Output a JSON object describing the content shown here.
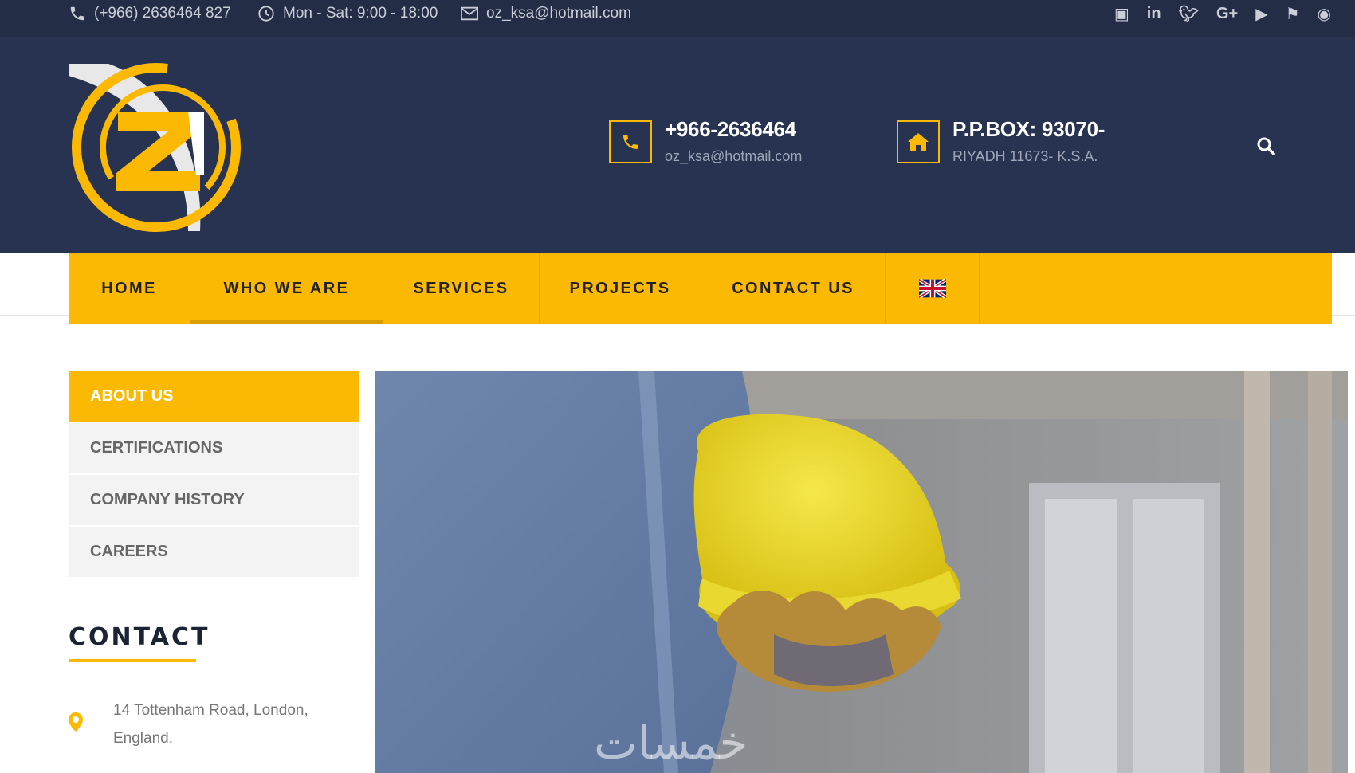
{
  "topbar": {
    "phone": "(+966) 2636464 827",
    "hours": "Mon - Sat: 9:00 - 18:00",
    "email": "oz_ksa@hotmail.com",
    "social_icons": [
      "facebook-icon",
      "linkedin-icon",
      "twitter-icon",
      "google-plus-icon",
      "youtube-icon",
      "foursquare-icon",
      "rss-icon"
    ]
  },
  "header": {
    "phone_title": "+966-2636464",
    "phone_sub": "oz_ksa@hotmail.com",
    "address_title": "P.P.BOX: 93070-",
    "address_sub": "RIYADH 11673- K.S.A."
  },
  "nav": {
    "items": [
      "HOME",
      "WHO WE ARE",
      "SERVICES",
      "PROJECTS",
      "CONTACT US"
    ],
    "active": "WHO WE ARE"
  },
  "sidebar": {
    "items": [
      "ABOUT US",
      "CERTIFICATIONS",
      "COMPANY HISTORY",
      "CAREERS"
    ],
    "active": "ABOUT US",
    "contact_heading": "CONTACT",
    "address": "14 Tottenham Road, London, England."
  },
  "watermark": "خمسات",
  "colors": {
    "accent": "#fbb903",
    "header_bg": "#273350",
    "topbar_bg": "#232d45"
  }
}
